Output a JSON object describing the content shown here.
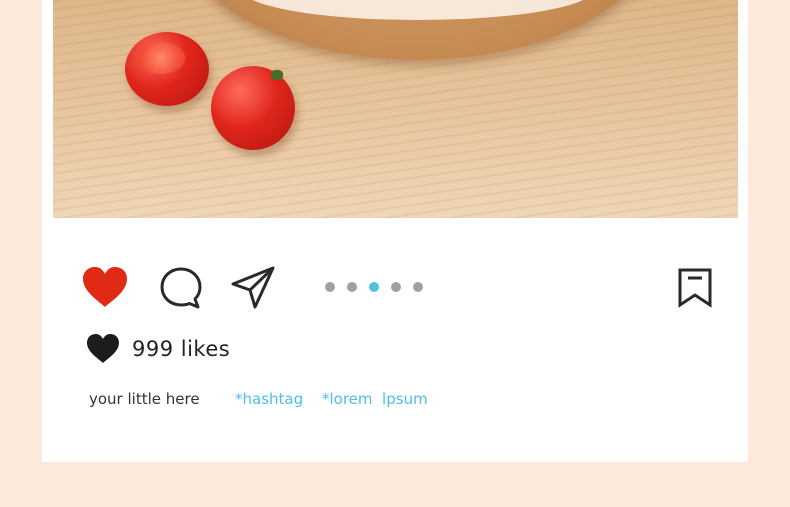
{
  "post": {
    "likes_text": "999 likes",
    "caption": "your little here",
    "tags": [
      "*hashtag",
      "*lorem  lpsum"
    ],
    "carousel": {
      "count": 5,
      "active_index": 2
    }
  },
  "actions": {
    "like_icon": "heart-icon",
    "comment_icon": "comment-bubble-icon",
    "share_icon": "paper-plane-icon",
    "save_icon": "bookmark-icon"
  },
  "colors": {
    "like": "#e02a14",
    "accent": "#4fbfe4",
    "background": "#fde9dc",
    "dot_inactive": "#9ea0a3"
  }
}
